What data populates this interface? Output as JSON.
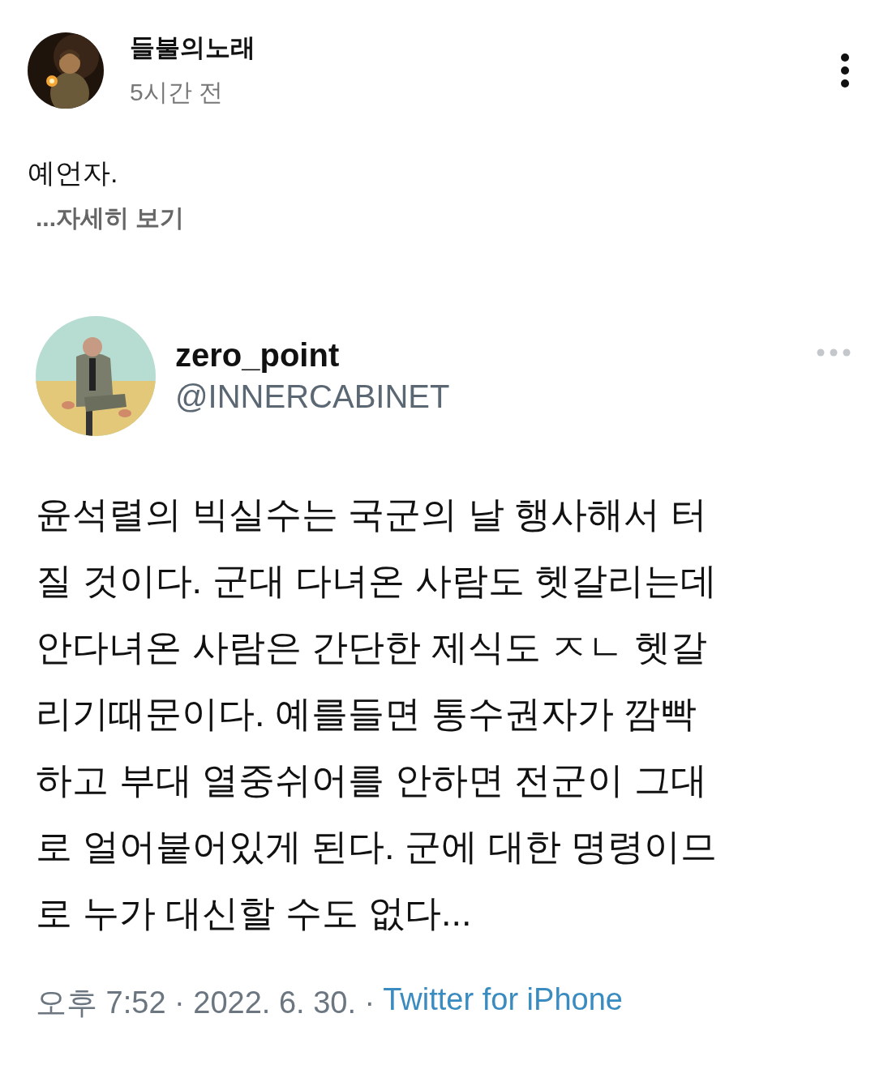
{
  "post": {
    "author": "들불의노래",
    "time": "5시간 전",
    "text": "예언자.",
    "more_link": "...자세히 보기"
  },
  "tweet": {
    "name": "zero_point",
    "handle": "@INNERCABINET",
    "lines": [
      "윤석렬의 빅실수는 국군의 날 행사해서 터",
      "질 것이다. 군대 다녀온 사람도 헷갈리는데",
      "안다녀온 사람은 간단한 제식도 ㅈㄴ 헷갈",
      "리기때문이다. 예를들면 통수권자가 깜빡",
      "하고 부대 열중쉬어를 안하면 전군이 그대",
      "로 얼어붙어있게 된다. 군에 대한 명령이므",
      "로 누가 대신할 수도 없다..."
    ],
    "meta": "오후 7:52 · 2022. 6. 30. ·",
    "source": "Twitter for iPhone"
  }
}
